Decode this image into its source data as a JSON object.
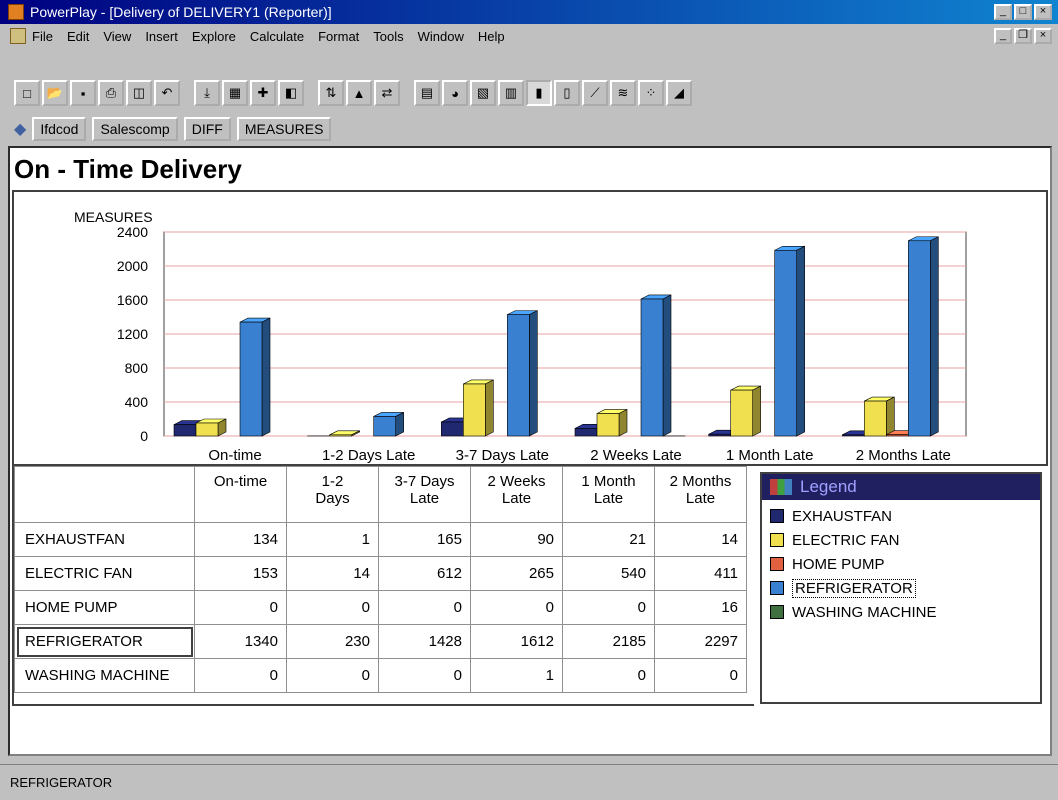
{
  "window": {
    "title": "PowerPlay - [Delivery of DELIVERY1 (Reporter)]"
  },
  "menu": [
    "File",
    "Edit",
    "View",
    "Insert",
    "Explore",
    "Calculate",
    "Format",
    "Tools",
    "Window",
    "Help"
  ],
  "dimensions": [
    "Ifdcod",
    "Salescomp",
    "DIFF",
    "MEASURES"
  ],
  "report": {
    "title": "On - Time Delivery"
  },
  "chart_data": {
    "type": "bar",
    "ylabel": "MEASURES",
    "ylim": [
      0,
      2400
    ],
    "yticks": [
      0,
      400,
      800,
      1200,
      1600,
      2000,
      2400
    ],
    "categories": [
      "On-time",
      "1-2 Days Late",
      "3-7 Days Late",
      "2 Weeks Late",
      "1 Month Late",
      "2 Months Late"
    ],
    "series": [
      {
        "name": "EXHAUSTFAN",
        "color": "#202870",
        "values": [
          134,
          1,
          165,
          90,
          21,
          14
        ]
      },
      {
        "name": "ELECTRIC FAN",
        "color": "#f0e050",
        "values": [
          153,
          14,
          612,
          265,
          540,
          411
        ]
      },
      {
        "name": "HOME PUMP",
        "color": "#e06040",
        "values": [
          0,
          0,
          0,
          0,
          0,
          16
        ]
      },
      {
        "name": "REFRIGERATOR",
        "color": "#3a80d0",
        "values": [
          1340,
          230,
          1428,
          1612,
          2185,
          2297
        ]
      },
      {
        "name": "WASHING MACHINE",
        "color": "#407040",
        "values": [
          0,
          0,
          0,
          1,
          0,
          0
        ]
      }
    ]
  },
  "table": {
    "headers": [
      "On-time",
      "1-2\nDays",
      "3-7 Days\nLate",
      "2 Weeks\nLate",
      "1 Month\nLate",
      "2 Months\nLate"
    ],
    "rows": [
      {
        "label": "EXHAUSTFAN",
        "values": [
          "134",
          "1",
          "165",
          "90",
          "21",
          "14"
        ]
      },
      {
        "label": "ELECTRIC FAN",
        "values": [
          "153",
          "14",
          "612",
          "265",
          "540",
          "411"
        ]
      },
      {
        "label": "HOME PUMP",
        "values": [
          "0",
          "0",
          "0",
          "0",
          "0",
          "16"
        ]
      },
      {
        "label": "REFRIGERATOR",
        "values": [
          "1340",
          "230",
          "1428",
          "1612",
          "2185",
          "2297"
        ]
      },
      {
        "label": "WASHING MACHINE",
        "values": [
          "0",
          "0",
          "0",
          "1",
          "0",
          "0"
        ]
      }
    ]
  },
  "legend": {
    "title": "Legend",
    "items": [
      "EXHAUSTFAN",
      "ELECTRIC FAN",
      "HOME PUMP",
      "REFRIGERATOR",
      "WASHING MACHINE"
    ]
  },
  "status": {
    "text": "REFRIGERATOR"
  }
}
